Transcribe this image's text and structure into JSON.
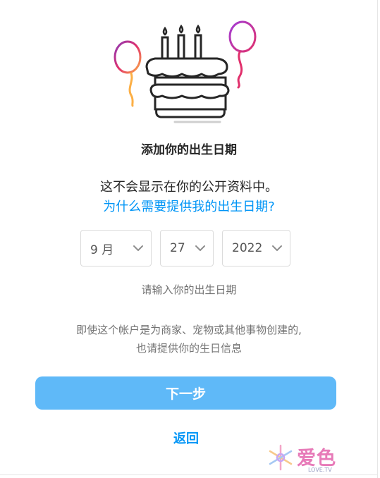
{
  "dialog": {
    "title": "添加你的出生日期",
    "description": "这不会显示在你的公开资料中。",
    "why_link": "为什么需要提供我的出生日期?",
    "birthday": {
      "month": "9 月",
      "day": "27",
      "year": "2022"
    },
    "hint": "请输入你的出生日期",
    "note_line1": "即使这个帐户是为商家、宠物或其他事物创建的,",
    "note_line2": "也请提供你的生日信息",
    "next_button": "下一步",
    "back_link": "返回"
  },
  "illustration": {
    "icon": "birthday-cake-with-balloons-icon"
  },
  "watermark": {
    "text": "爱色",
    "sub": "LOVE.TV"
  },
  "colors": {
    "link": "#0095f6",
    "button": "#5fb9f8",
    "text": "#262626",
    "secondary": "#737373",
    "border": "#dbdbdb"
  }
}
